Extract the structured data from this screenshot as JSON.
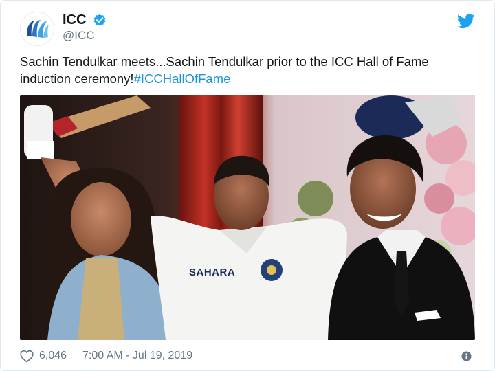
{
  "account": {
    "name": "ICC",
    "handle": "@ICC"
  },
  "tweet": {
    "text": "Sachin Tendulkar meets...Sachin Tendulkar prior to the ICC Hall of Fame induction ceremony!",
    "hashtag": "#ICCHallOfFame"
  },
  "photo": {
    "jersey_sponsor": "SAHARA"
  },
  "footer": {
    "likes": "6,046",
    "timestamp": "7:00 AM - Jul 19, 2019"
  },
  "colors": {
    "twitter_blue": "#1da1f2",
    "hashtag": "#1b95e0",
    "secondary_text": "#657786"
  },
  "icons": [
    "icc-logo-icon",
    "verified-badge-icon",
    "twitter-bird-icon",
    "heart-icon",
    "info-icon"
  ]
}
